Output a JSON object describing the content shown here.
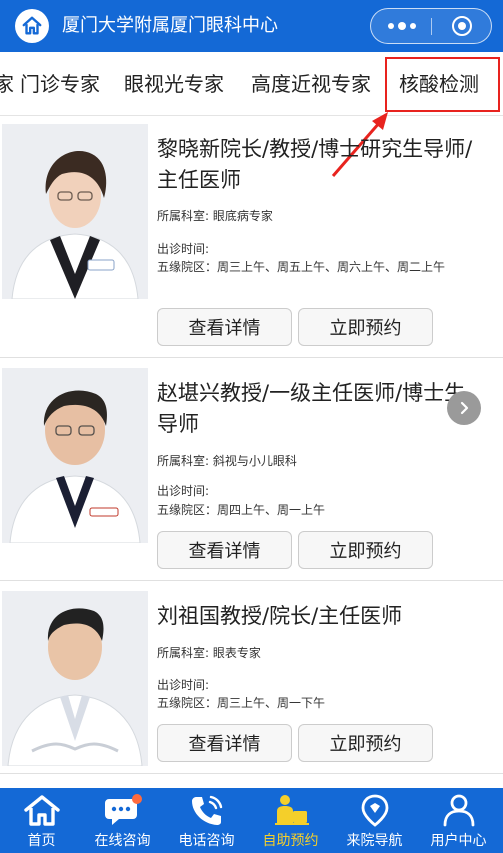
{
  "header": {
    "title": "厦门大学附属厦门眼科中心",
    "home_icon": "home-icon",
    "more_icon": "more-dots-icon",
    "close_icon": "target-close-icon",
    "color": "#1469d6"
  },
  "tabs": {
    "partial_label": "家",
    "items": [
      {
        "label": "门诊专家"
      },
      {
        "label": "眼视光专家"
      },
      {
        "label": "高度近视专家"
      },
      {
        "label": "核酸检测"
      }
    ],
    "highlight_color": "#e8231e"
  },
  "doctors": [
    {
      "name": "黎晓新院长/教授/博士研究生导师/主任医师",
      "dept": "所属科室: 眼底病专家",
      "time_label": "出诊时间:",
      "schedule": "五缘院区：周三上午、周五上午、周六上午、周二上午",
      "detail_label": "查看详情",
      "book_label": "立即预约"
    },
    {
      "name": "赵堪兴教授/一级主任医师/博士生导师",
      "dept": "所属科室: 斜视与小儿眼科",
      "time_label": "出诊时间:",
      "schedule": "五缘院区：周四上午、周一上午",
      "detail_label": "查看详情",
      "book_label": "立即预约"
    },
    {
      "name": "刘祖国教授/院长/主任医师",
      "dept": "所属科室: 眼表专家",
      "time_label": "出诊时间:",
      "schedule": "五缘院区：周三上午、周一下午",
      "detail_label": "查看详情",
      "book_label": "立即预约"
    }
  ],
  "bottom_nav": [
    {
      "label": "首页",
      "icon": "home-icon"
    },
    {
      "label": "在线咨询",
      "icon": "chat-bubble-icon"
    },
    {
      "label": "电话咨询",
      "icon": "phone-icon"
    },
    {
      "label": "自助预约",
      "icon": "appointment-icon",
      "active": true
    },
    {
      "label": "来院导航",
      "icon": "location-pin-icon"
    },
    {
      "label": "用户中心",
      "icon": "user-icon"
    }
  ],
  "active_color": "#f4cf2a"
}
